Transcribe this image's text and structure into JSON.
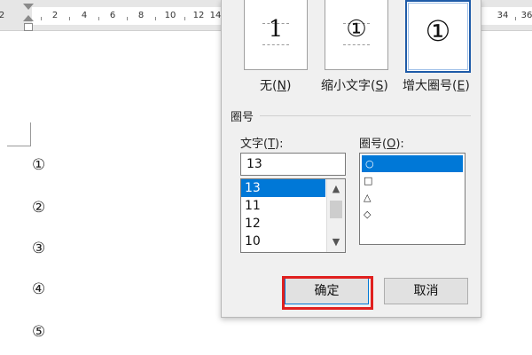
{
  "ruler": {
    "labels": [
      "2",
      "2",
      "4",
      "6",
      "8",
      "10",
      "12",
      "14",
      "34",
      "36"
    ]
  },
  "document": {
    "lines": [
      "①",
      "②",
      "③",
      "④",
      "⑤"
    ]
  },
  "dialog": {
    "styles": [
      {
        "preview": "1",
        "label_text": "无(",
        "label_key": "N",
        "label_end": ")"
      },
      {
        "preview": "①",
        "label_text": "缩小文字(",
        "label_key": "S",
        "label_end": ")"
      },
      {
        "preview": "①",
        "label_text": "增大圈号(",
        "label_key": "E",
        "label_end": ")"
      }
    ],
    "selected_style": 2,
    "section_title": "圈号",
    "text_label": {
      "text": "文字(",
      "key": "T",
      "end": "):"
    },
    "enclose_label": {
      "text": "圈号(",
      "key": "O",
      "end": "):"
    },
    "text_value": "13",
    "text_options": [
      "13",
      "11",
      "12",
      "10"
    ],
    "enclose_options": [
      "○",
      "□",
      "△",
      "◇"
    ],
    "ok_label": "确定",
    "cancel_label": "取消",
    "highlight_color": "#e0201f",
    "accent_color": "#0078d7"
  }
}
